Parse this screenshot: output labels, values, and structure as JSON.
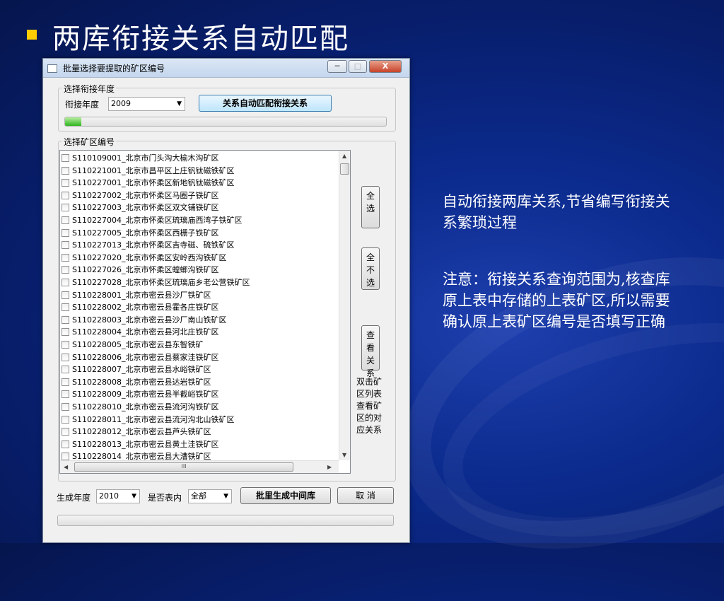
{
  "slide": {
    "title": "两库衔接关系自动匹配",
    "note1": "自动衔接两库关系,节省编写衔接关系繁琐过程",
    "note2": "注意：衔接关系查询范围为,核查库原上表中存储的上表矿区,所以需要确认原上表矿区编号是否填写正确"
  },
  "window": {
    "title": "批量选择要提取的矿区编号",
    "min_label": "─",
    "max_label": "□",
    "close_label": "X"
  },
  "year_group": {
    "label": "选择衔接年度",
    "field_label": "衔接年度",
    "year_value": "2009",
    "match_button": "关系自动匹配衔接关系",
    "progress": 0.05
  },
  "mine_group": {
    "label": "选择矿区编号",
    "items": [
      "S110109001_北京市门头沟大榆木沟矿区",
      "S110221001_北京市昌平区上庄钒钛磁铁矿区",
      "S110227001_北京市怀柔区新地钒钛磁铁矿区",
      "S110227002_北京市怀柔区马圈子铁矿区",
      "S110227003_北京市怀柔区双文铺铁矿区",
      "S110227004_北京市怀柔区琉璃庙西湾子铁矿区",
      "S110227005_北京市怀柔区西栅子铁矿区",
      "S110227013_北京市怀柔区吉寺磁、硫铁矿区",
      "S110227020_北京市怀柔区安岭西沟铁矿区",
      "S110227026_北京市怀柔区蝗螂沟铁矿区",
      "S110227028_北京市怀柔区琉璃庙乡老公营铁矿区",
      "S110228001_北京市密云县沙厂铁矿区",
      "S110228002_北京市密云县霍各庄铁矿区",
      "S110228003_北京市密云县沙厂南山铁矿区",
      "S110228004_北京市密云县河北庄铁矿区",
      "S110228005_北京市密云县东智铁矿",
      "S110228006_北京市密云县蔡家洼铁矿区",
      "S110228007_北京市密云县水峪铁矿区",
      "S110228008_北京市密云县达岩铁矿区",
      "S110228009_北京市密云县半截峪铁矿区",
      "S110228010_北京市密云县流河沟铁矿区",
      "S110228011_北京市密云县流河沟北山铁矿区",
      "S110228012_北京市密云县芦头铁矿区",
      "S110228013_北京市密云县黄土洼铁矿区",
      "S110228014_北京市密云县大漕铁矿区"
    ],
    "select_all": "全选",
    "deselect_all": "全不选",
    "view_relation": "查看关系",
    "hint": "双击矿区列表查看矿区的对应关系",
    "hscroll_label": "III"
  },
  "footer": {
    "gen_year_label": "生成年度",
    "gen_year_value": "2010",
    "in_table_label": "是否表内",
    "in_table_value": "全部",
    "generate_button": "批里生成中间库",
    "cancel_button": "取 消",
    "progress": 0
  },
  "colors": {
    "bullet": "#ffcc00",
    "background": "#0b2a8c",
    "progress_fill": "#2fb41e"
  }
}
